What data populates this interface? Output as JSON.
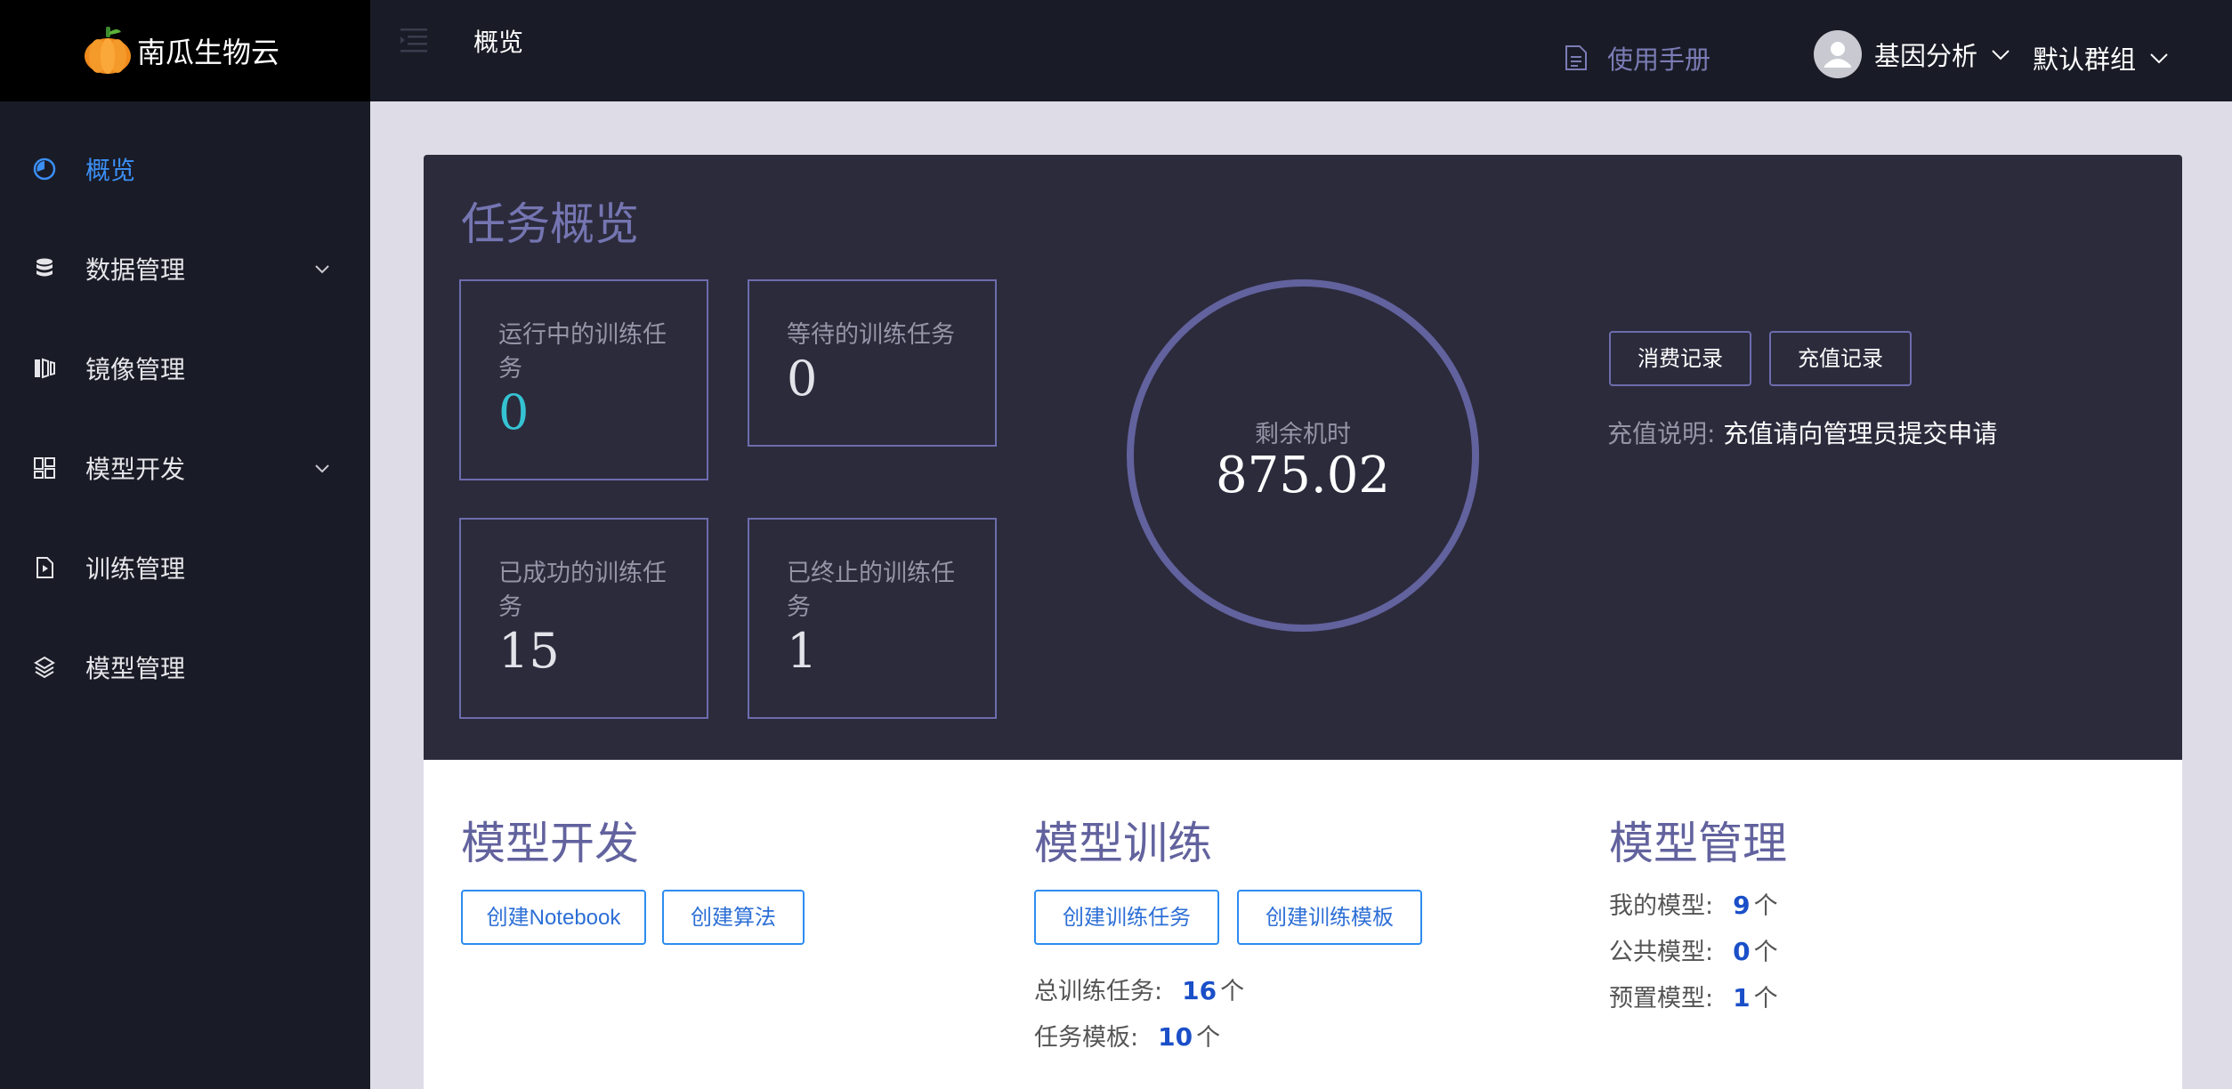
{
  "app": {
    "name": "南瓜生物云"
  },
  "sidebar": {
    "items": [
      {
        "label": "概览",
        "icon": "pie-chart-icon",
        "active": true,
        "has_children": false
      },
      {
        "label": "数据管理",
        "icon": "database-icon",
        "active": false,
        "has_children": true
      },
      {
        "label": "镜像管理",
        "icon": "image-layers-icon",
        "active": false,
        "has_children": false
      },
      {
        "label": "模型开发",
        "icon": "grid-blocks-icon",
        "active": false,
        "has_children": true
      },
      {
        "label": "训练管理",
        "icon": "play-document-icon",
        "active": false,
        "has_children": false
      },
      {
        "label": "模型管理",
        "icon": "cube-stack-icon",
        "active": false,
        "has_children": false
      }
    ]
  },
  "header": {
    "title": "概览",
    "manual_label": "使用手册",
    "user_name": "基因分析",
    "group_name": "默认群组"
  },
  "overview": {
    "title": "任务概览",
    "cards": [
      {
        "label": "运行中的训练任务",
        "value": "0"
      },
      {
        "label": "等待的训练任务",
        "value": "0"
      },
      {
        "label": "已成功的训练任务",
        "value": "15"
      },
      {
        "label": "已终止的训练任务",
        "value": "1"
      }
    ],
    "remaining_label": "剩余机时",
    "remaining_value": "875.02",
    "consume_button": "消费记录",
    "recharge_button": "充值记录",
    "recharge_note_key": "充值说明:",
    "recharge_note_value": "充值请向管理员提交申请"
  },
  "model_dev": {
    "title": "模型开发",
    "create_notebook": "创建Notebook",
    "create_algorithm": "创建算法"
  },
  "model_train": {
    "title": "模型训练",
    "create_task": "创建训练任务",
    "create_template": "创建训练模板",
    "total_label": "总训练任务:",
    "total_value": "16",
    "template_label": "任务模板:",
    "template_value": "10",
    "unit": "个"
  },
  "model_mgmt": {
    "title": "模型管理",
    "my_label": "我的模型:",
    "my_value": "9",
    "public_label": "公共模型:",
    "public_value": "0",
    "preset_label": "预置模型:",
    "preset_value": "1",
    "unit": "个"
  },
  "colors": {
    "sidebar_bg": "#191b26",
    "active": "#3b8ff5",
    "panel_bg": "#2c2b3c",
    "accent_purple": "#6d6cad",
    "teal": "#35c3d3",
    "link_blue": "#2d8cf0"
  }
}
